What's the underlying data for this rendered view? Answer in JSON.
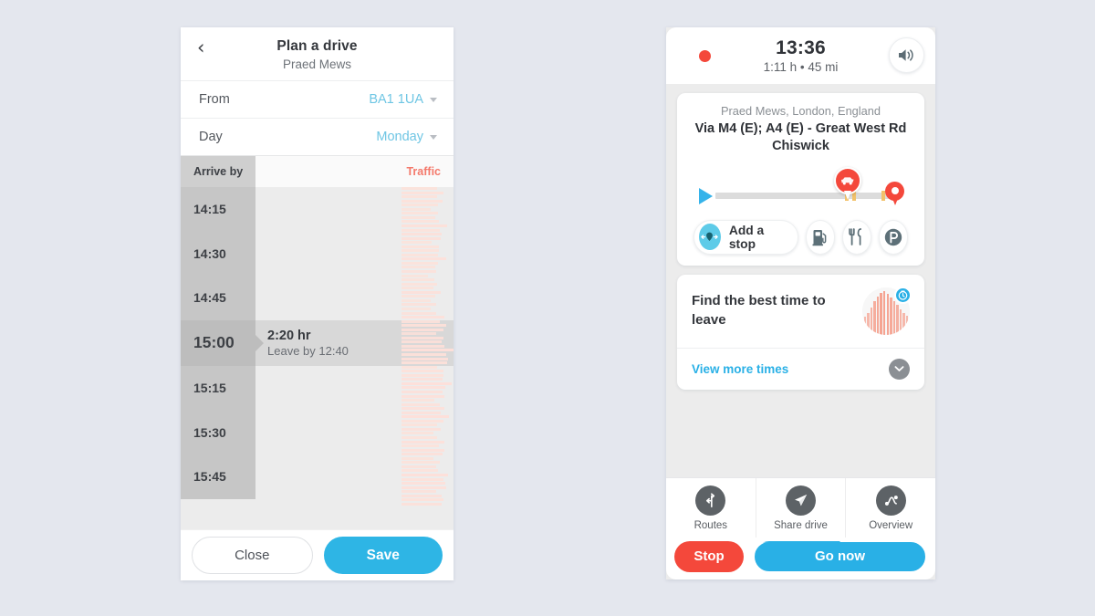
{
  "page": {
    "background": "#e4e7ee"
  },
  "colors": {
    "accent_blue": "#29b0e6",
    "save_blue": "#2eb5e5",
    "traffic_red": "#f4796b",
    "stop_red": "#f4483b",
    "link_blue": "#6fc6e4"
  },
  "plan_panel": {
    "back_icon": "chevron-left-icon",
    "title": "Plan a drive",
    "subtitle": "Praed Mews",
    "fields": [
      {
        "label": "From",
        "value": "BA1 1UA"
      },
      {
        "label": "Day",
        "value": "Monday"
      }
    ],
    "columns": {
      "time": "Arrive by",
      "traffic": "Traffic"
    },
    "rows": [
      {
        "time": "14:15",
        "selected": false
      },
      {
        "time": "14:30",
        "selected": false
      },
      {
        "time": "14:45",
        "selected": false
      },
      {
        "time": "15:00",
        "selected": true,
        "duration": "2:20 hr",
        "leave_by": "Leave by 12:40"
      },
      {
        "time": "15:15",
        "selected": false
      },
      {
        "time": "15:30",
        "selected": false
      },
      {
        "time": "15:45",
        "selected": false
      }
    ],
    "buttons": {
      "close": "Close",
      "save": "Save"
    }
  },
  "nav_panel": {
    "status": {
      "recording_icon": "record-dot-icon",
      "clock": "13:36",
      "meta": "1:11 h • 45 mi",
      "speaker_icon": "speaker-icon"
    },
    "route": {
      "destination": "Praed Mews, London, England",
      "via": "Via M4 (E); A4 (E) - Great West Rd Chiswick",
      "start_icon": "start-arrow-icon",
      "traffic_marker_icon": "traffic-jam-icon",
      "destination_pin_icon": "destination-pin-icon",
      "actions": [
        {
          "label": "Add a stop",
          "icon": "add-stop-pin-icon"
        },
        {
          "label": "",
          "icon": "gas-station-icon"
        },
        {
          "label": "",
          "icon": "restaurant-icon"
        },
        {
          "label": "",
          "icon": "parking-icon"
        }
      ]
    },
    "best_time": {
      "title": "Find the best time to leave",
      "badge_icon": "clock-icon",
      "view_more": "View more times",
      "chevron_icon": "chevron-down-icon"
    },
    "bottom_nav": [
      {
        "label": "Routes",
        "icon": "routes-signpost-icon"
      },
      {
        "label": "Share drive",
        "icon": "share-paper-plane-icon"
      },
      {
        "label": "Overview",
        "icon": "overview-route-icon"
      }
    ],
    "actions": {
      "stop": "Stop",
      "go_now": "Go now"
    }
  },
  "chart_data": {
    "type": "bar",
    "title": "Traffic",
    "orientation": "horizontal",
    "categories": [
      "14:15",
      "14:30",
      "14:45",
      "15:00",
      "15:15",
      "15:30",
      "15:45"
    ],
    "values": [
      68,
      74,
      61,
      86,
      79,
      72,
      83
    ],
    "xlabel": "Traffic level",
    "ylabel": "Arrive by",
    "note": "Dense horizontal salmon stripes whose lengths vary with traffic congestion across the arrival window"
  }
}
